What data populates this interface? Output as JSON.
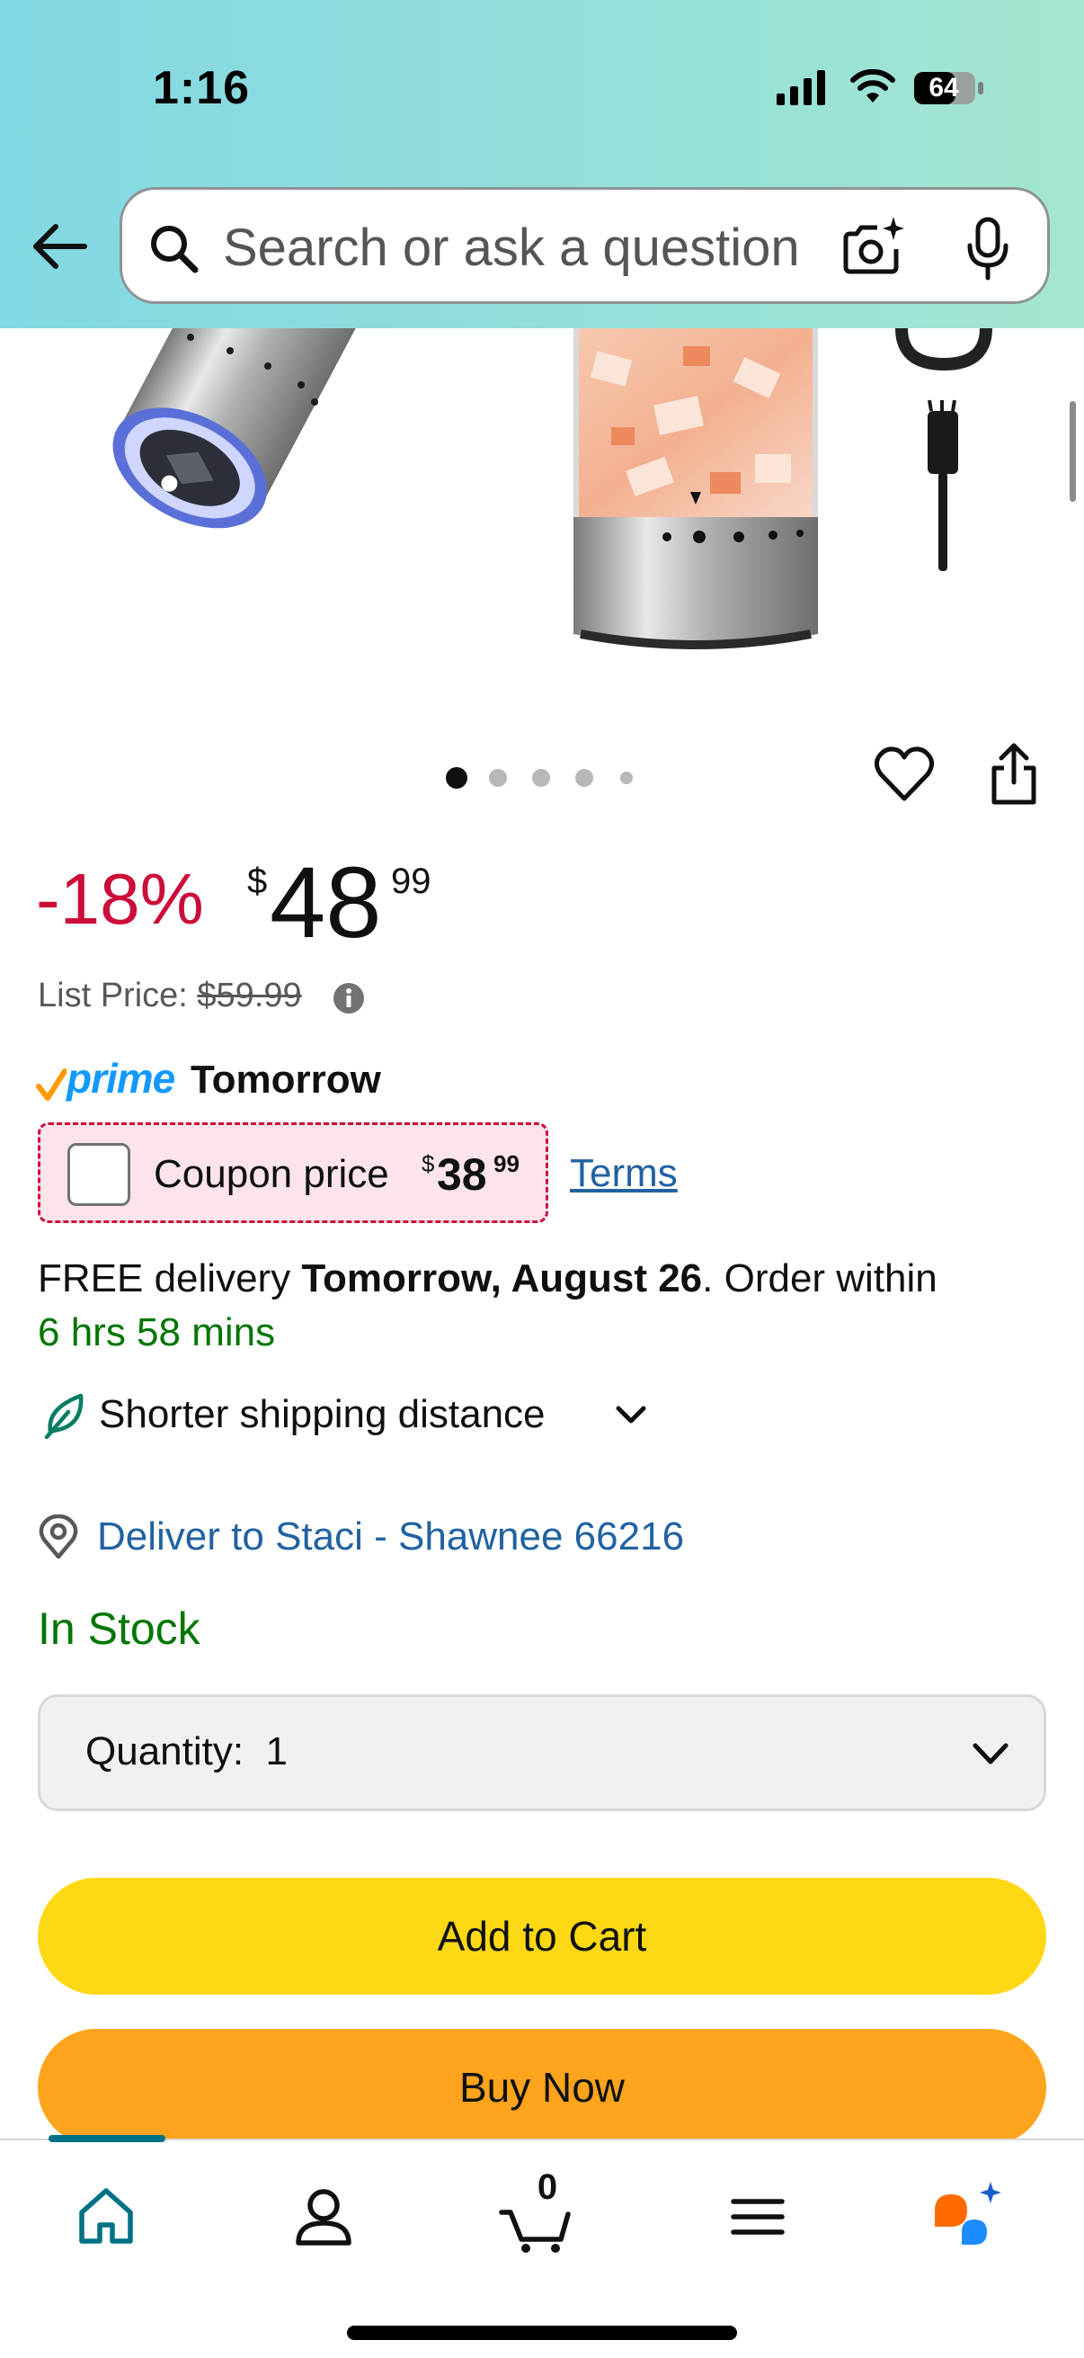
{
  "status_bar": {
    "time": "1:16",
    "battery": "64"
  },
  "header": {
    "search_placeholder": "Search or ask a question"
  },
  "gallery": {
    "image_count": 5,
    "active_index": 0
  },
  "price": {
    "discount": "-18%",
    "currency_symbol": "$",
    "whole": "48",
    "fraction": "99",
    "list_price_label": "List Price:",
    "list_price_value": "$59.99"
  },
  "prime": {
    "brand": "prime",
    "delivery_day": "Tomorrow"
  },
  "coupon": {
    "label": "Coupon price",
    "currency_symbol": "$",
    "whole": "38",
    "fraction": "99",
    "terms_label": "Terms"
  },
  "delivery": {
    "prefix": "FREE delivery ",
    "date": "Tomorrow, August 26",
    "middle": ". Order within",
    "countdown": "6 hrs 58 mins",
    "shorter_shipping": "Shorter shipping distance",
    "deliver_to": "Deliver to Staci - Shawnee 66216"
  },
  "stock": {
    "status": "In Stock"
  },
  "quantity": {
    "label": "Quantity:",
    "value": "1"
  },
  "buttons": {
    "add_to_cart": "Add to Cart",
    "buy_now": "Buy Now"
  },
  "bottom_nav": {
    "cart_count": "0"
  },
  "colors": {
    "discount_red": "#cc0c39",
    "link_blue": "#2162a1",
    "in_stock_green": "#007600",
    "add_to_cart_yellow": "#ffd814",
    "buy_now_orange": "#ffa41c",
    "prime_blue": "#1399ff"
  },
  "icons": [
    "back-arrow-icon",
    "search-icon",
    "camera-icon",
    "mic-icon",
    "heart-icon",
    "share-icon",
    "info-icon",
    "leaf-icon",
    "location-pin-icon",
    "chevron-down-icon",
    "home-icon",
    "account-icon",
    "cart-icon",
    "menu-icon",
    "rufus-icon"
  ]
}
